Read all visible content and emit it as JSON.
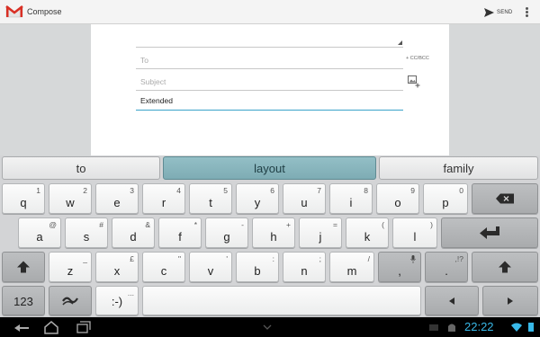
{
  "actionbar": {
    "title": "Compose",
    "send_label": "SEND",
    "app_icon": "gmail-icon",
    "send_icon": "send-icon",
    "menu_icon": "overflow-menu-icon"
  },
  "compose": {
    "to_placeholder": "To",
    "cc_bcc_label": "+ CC/BCC",
    "subject_placeholder": "Subject",
    "body_text": "Extended",
    "attach_icon": "attach-picture-icon"
  },
  "suggestions": [
    {
      "label": "to",
      "active": false
    },
    {
      "label": "layout",
      "active": true
    },
    {
      "label": "family",
      "active": false
    }
  ],
  "keyboard": {
    "row1": [
      {
        "main": "q",
        "alt": "1"
      },
      {
        "main": "w",
        "alt": "2"
      },
      {
        "main": "e",
        "alt": "3"
      },
      {
        "main": "r",
        "alt": "4"
      },
      {
        "main": "t",
        "alt": "5"
      },
      {
        "main": "y",
        "alt": "6"
      },
      {
        "main": "u",
        "alt": "7"
      },
      {
        "main": "i",
        "alt": "8"
      },
      {
        "main": "o",
        "alt": "9"
      },
      {
        "main": "p",
        "alt": "0"
      }
    ],
    "row2": [
      {
        "main": "a",
        "alt": "@"
      },
      {
        "main": "s",
        "alt": "#"
      },
      {
        "main": "d",
        "alt": "&"
      },
      {
        "main": "f",
        "alt": "*"
      },
      {
        "main": "g",
        "alt": "-"
      },
      {
        "main": "h",
        "alt": "+"
      },
      {
        "main": "j",
        "alt": "="
      },
      {
        "main": "k",
        "alt": "("
      },
      {
        "main": "l",
        "alt": ")"
      }
    ],
    "row3": [
      {
        "main": "z",
        "alt": "_"
      },
      {
        "main": "x",
        "alt": "£"
      },
      {
        "main": "c",
        "alt": "\""
      },
      {
        "main": "v",
        "alt": "'"
      },
      {
        "main": "b",
        "alt": ":"
      },
      {
        "main": "n",
        "alt": ";"
      },
      {
        "main": "m",
        "alt": "/"
      }
    ],
    "comma": {
      "main": ",",
      "alt": "mic"
    },
    "period": {
      "main": ".",
      "alt": ",!?"
    },
    "numbers_label": "123",
    "emoticon_label": ":-)",
    "emoticon_alt": "...",
    "icons": {
      "backspace": "backspace-icon",
      "enter": "enter-icon",
      "shift": "shift-icon",
      "swype": "swype-icon",
      "left": "cursor-left-icon",
      "right": "cursor-right-icon",
      "mic": "mic-icon"
    }
  },
  "statusbar": {
    "time": "22:22"
  },
  "colors": {
    "accent": "#3aa3c9",
    "suggestion_active": "#86b3bb",
    "clock": "#38b8e8"
  }
}
